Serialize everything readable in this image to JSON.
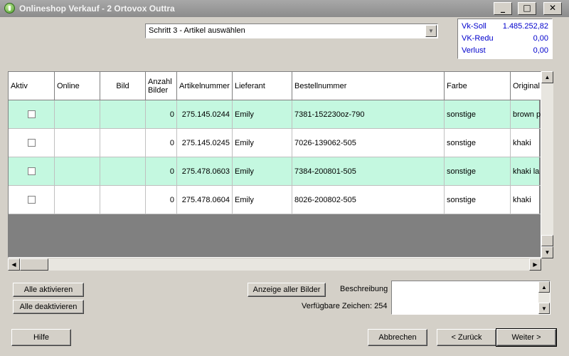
{
  "window": {
    "title": "Onlineshop Verkauf - 2 Ortovox Outtra"
  },
  "step": {
    "value": "Schritt 3 - Artikel auswählen"
  },
  "summary": [
    {
      "label": "Vk-Soll",
      "value": "1.485.252,82"
    },
    {
      "label": "VK-Redu",
      "value": "0,00"
    },
    {
      "label": "Verlust",
      "value": "0,00"
    }
  ],
  "table": {
    "headers": {
      "aktiv": "Aktiv",
      "online": "Online",
      "bild": "Bild",
      "anzahl_1": "Anzahl",
      "anzahl_2": "Bilder",
      "artikelnummer": "Artikelnummer",
      "lieferant": "Lieferant",
      "bestellnummer": "Bestellnummer",
      "farbe": "Farbe",
      "original": "Original"
    },
    "rows": [
      {
        "anzahl": "0",
        "artikelnummer": "275.145.0244",
        "lieferant": "Emily",
        "bestellnummer": "7381-152230oz-790",
        "farbe": "sonstige",
        "original": "brown p"
      },
      {
        "anzahl": "0",
        "artikelnummer": "275.145.0245",
        "lieferant": "Emily",
        "bestellnummer": "7026-139062-505",
        "farbe": "sonstige",
        "original": "khaki"
      },
      {
        "anzahl": "0",
        "artikelnummer": "275.478.0603",
        "lieferant": "Emily",
        "bestellnummer": "7384-200801-505",
        "farbe": "sonstige",
        "original": "khaki la"
      },
      {
        "anzahl": "0",
        "artikelnummer": "275.478.0604",
        "lieferant": "Emily",
        "bestellnummer": "8026-200802-505",
        "farbe": "sonstige",
        "original": "khaki"
      }
    ]
  },
  "buttons": {
    "alle_aktivieren": "Alle aktivieren",
    "alle_deaktivieren": "Alle deaktivieren",
    "anzeige_bilder": "Anzeige aller Bilder",
    "hilfe": "Hilfe",
    "abbrechen": "Abbrechen",
    "zurueck": "< Zurück",
    "weiter": "Weiter >"
  },
  "description": {
    "label": "Beschreibung",
    "chars": "Verfügbare Zeichen: 254"
  },
  "colors": {
    "row_alt": "#c4f8e0",
    "summary_text": "#0000cc"
  }
}
